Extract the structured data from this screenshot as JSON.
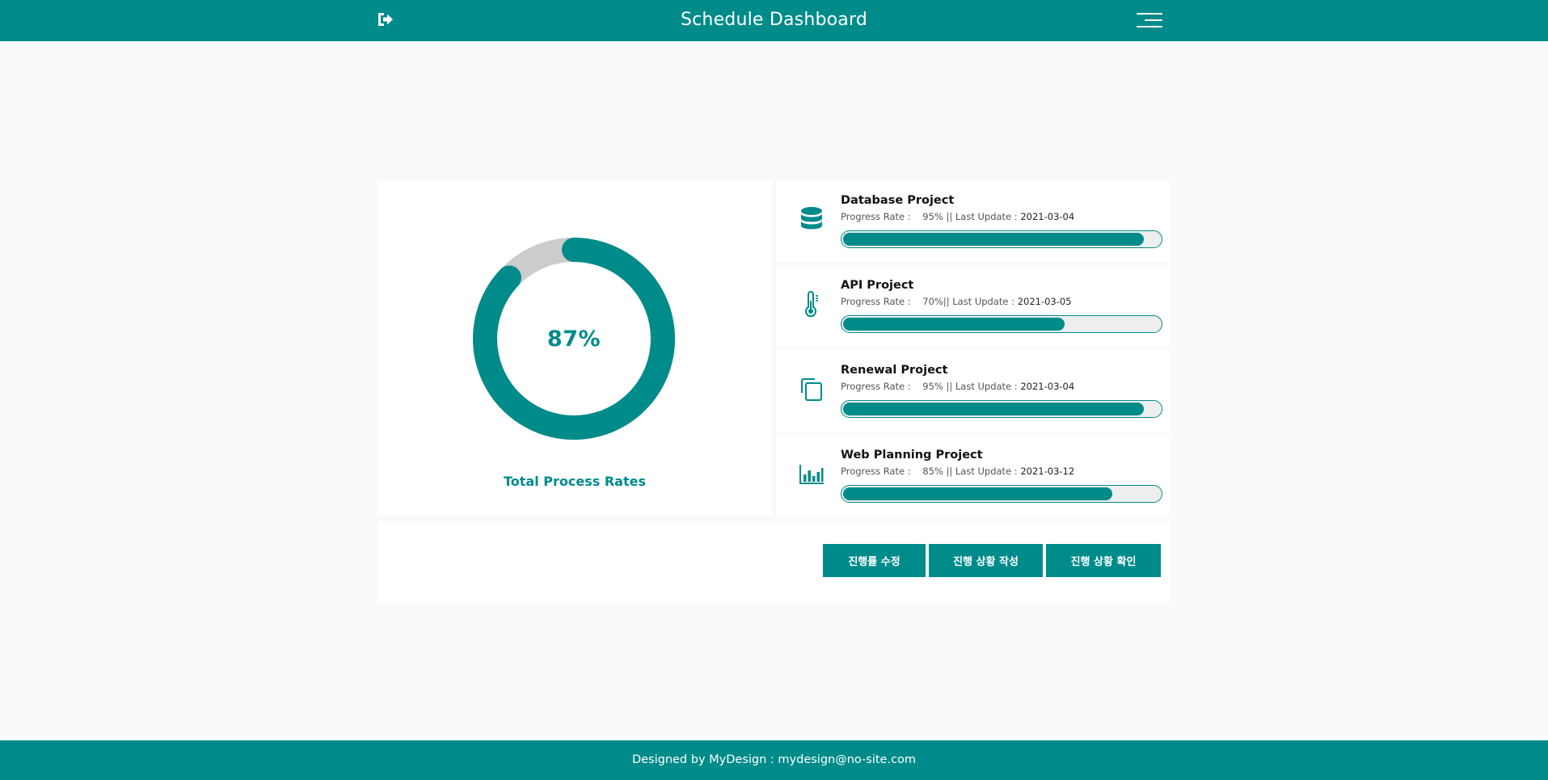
{
  "header": {
    "title": "Schedule Dashboard",
    "logout_icon": "sign-out-icon",
    "menu_icon": "hamburger-menu-icon"
  },
  "summary": {
    "value_label": "87%",
    "progress": 0.87,
    "label": "Total Process Rates"
  },
  "projects": [
    {
      "name": "Database Project",
      "rate_label": "Progress Rate :",
      "rate": "95% || Last Update :",
      "date": "2021-03-04",
      "progress": 0.95,
      "icon": "database-icon"
    },
    {
      "name": "API Project",
      "rate_label": "Progress Rate :",
      "rate": "70%|| Last Update :",
      "date": "2021-03-05",
      "progress": 0.7,
      "icon": "thermometer-icon"
    },
    {
      "name": "Renewal Project",
      "rate_label": "Progress Rate :",
      "rate": "95% || Last Update :",
      "date": "2021-03-04",
      "progress": 0.95,
      "icon": "copy-icon"
    },
    {
      "name": "Web Planning Project",
      "rate_label": "Progress Rate :",
      "rate": "85% || Last Update :",
      "date": "2021-03-12",
      "progress": 0.85,
      "icon": "bar-chart-icon"
    }
  ],
  "actions": {
    "edit_rate": "진행률 수정",
    "write_status": "진행 상황 작성",
    "check_status": "진행 상황 확인"
  },
  "footer": {
    "text": "Designed by MyDesign : mydesign@no-site.com"
  },
  "colors": {
    "accent": "#008b8b",
    "track": "#cccccc"
  }
}
